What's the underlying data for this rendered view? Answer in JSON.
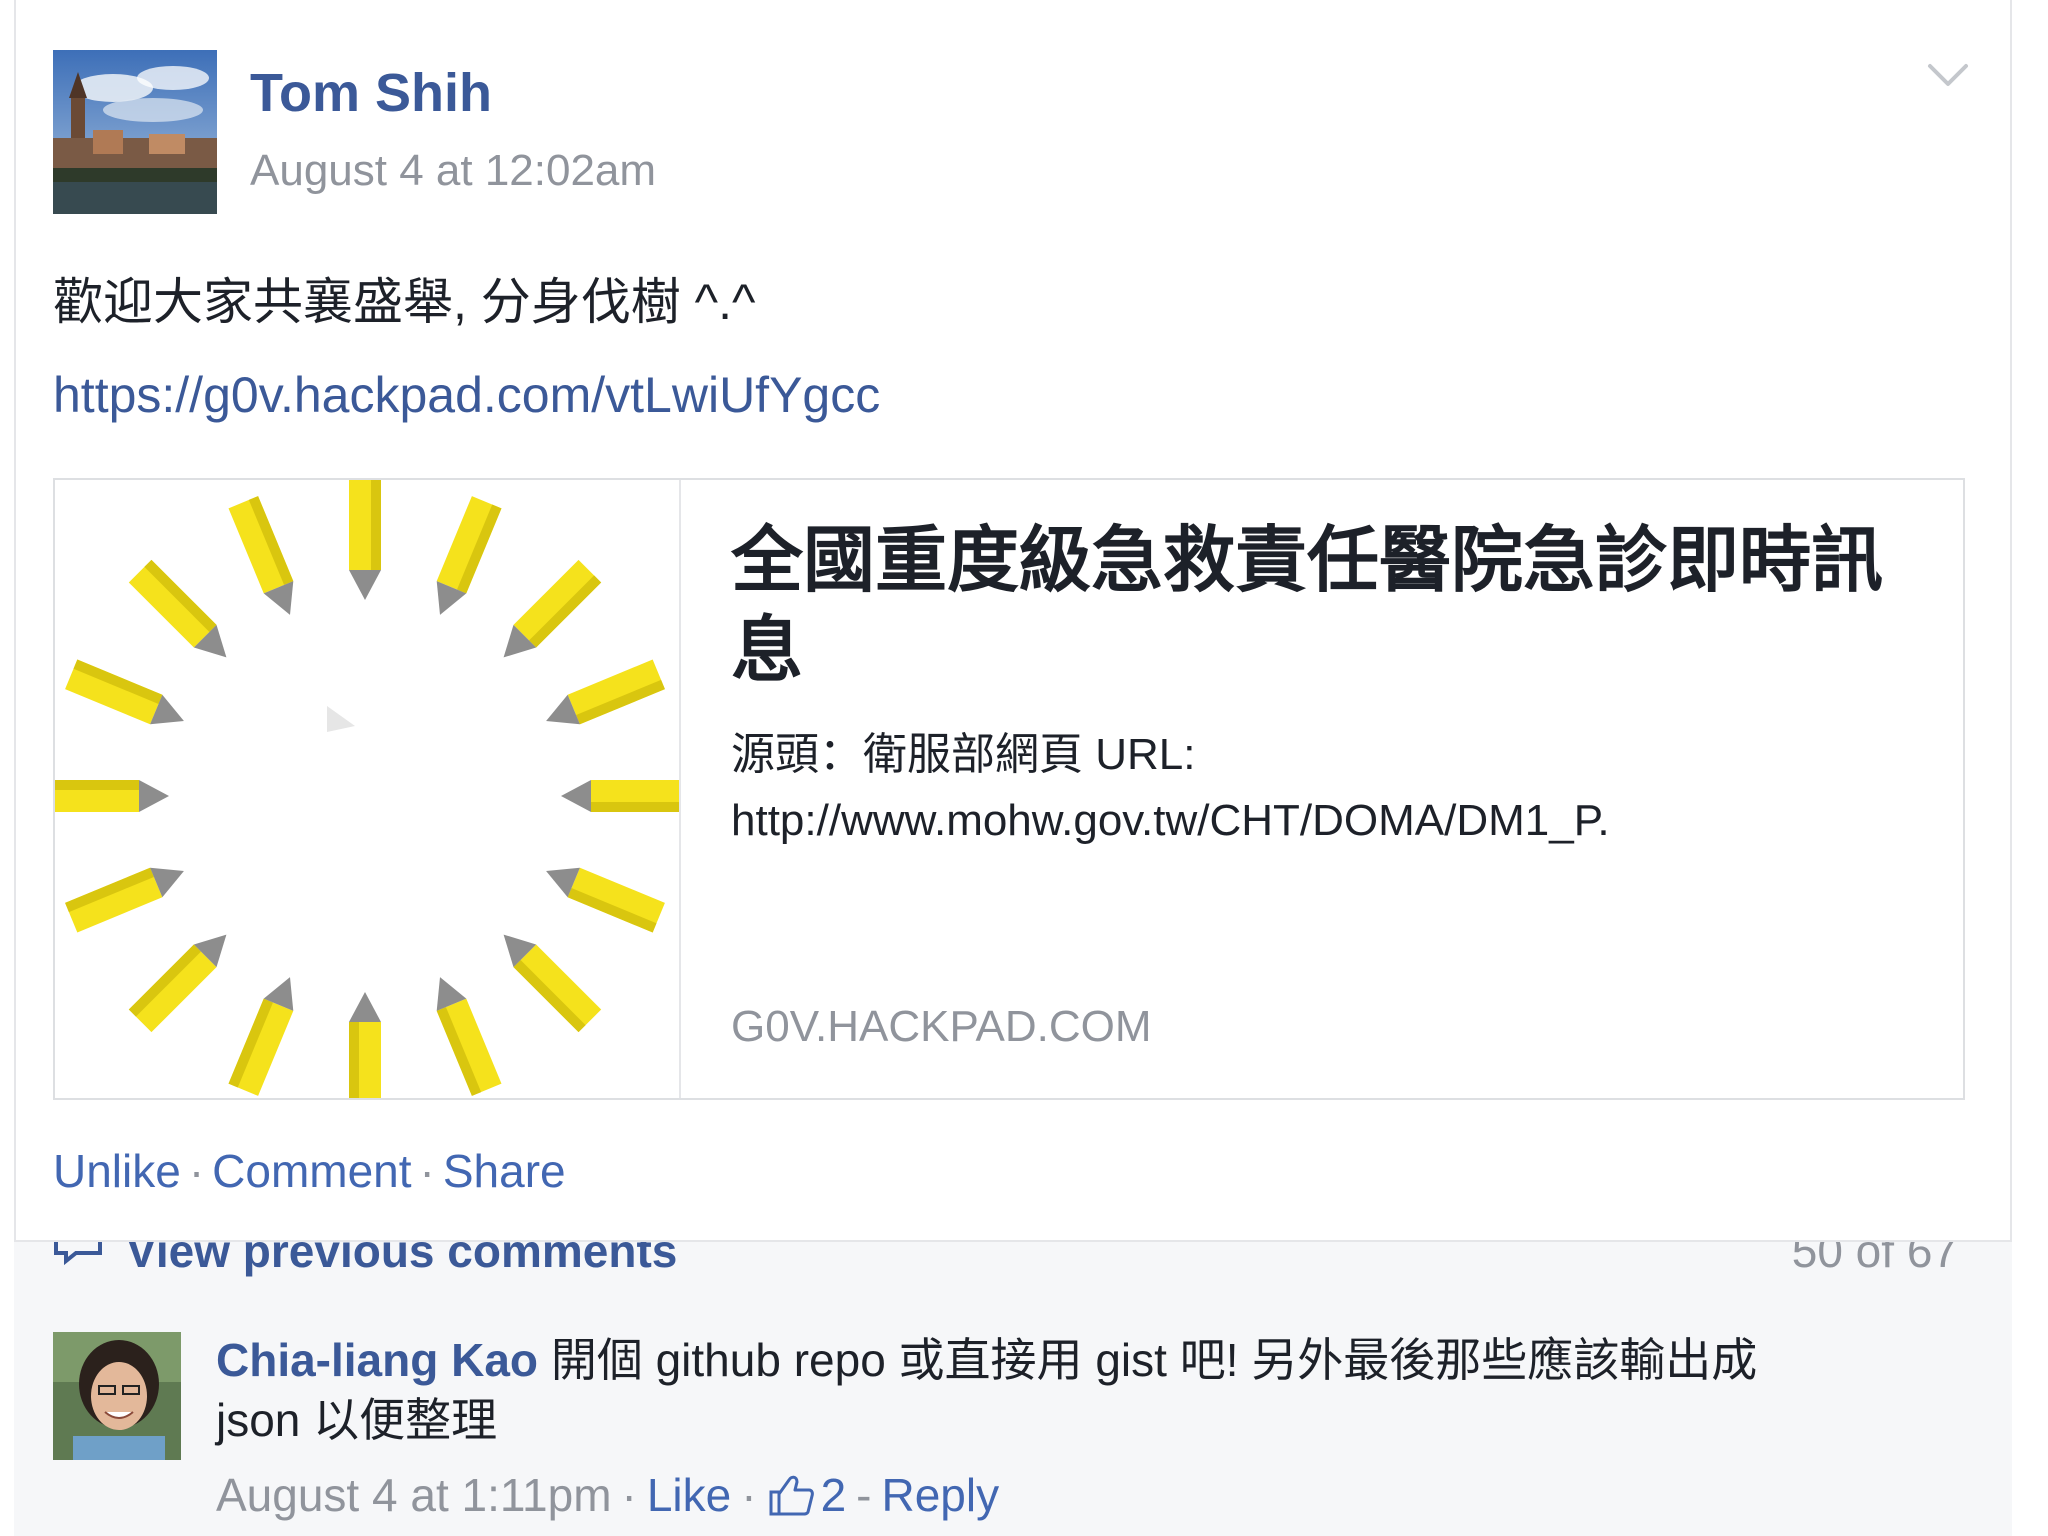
{
  "post": {
    "author": "Tom Shih",
    "timestamp": "August 4 at 12:02am",
    "text": "歡迎大家共襄盛舉, 分身伐樹 ^.^",
    "link": "https://g0v.hackpad.com/vtLwiUfYgcc",
    "menu_icon": "chevron-down-icon"
  },
  "link_preview": {
    "image_icon": "pencil-spinner-logo",
    "title": "全國重度級急救責任醫院急診即時訊息",
    "description_line1": "源頭：衛服部網頁 URL:",
    "description_line2": "http://www.mohw.gov.tw/CHT/DOMA/DM1_P.",
    "domain": "G0V.HACKPAD.COM"
  },
  "actions": {
    "unlike": "Unlike",
    "comment": "Comment",
    "share": "Share",
    "separator": "·"
  },
  "comments": {
    "view_previous": "View previous comments",
    "count": "50 of 67",
    "items": [
      {
        "author": "Chia-liang Kao",
        "text": "開個 github repo 或直接用 gist 吧! 另外最後那些應該輸出成 json 以便整理",
        "time": "August 4 at 1:11pm",
        "like_label": "Like",
        "like_count": "2",
        "reply_label": "Reply"
      }
    ]
  },
  "colors": {
    "link_blue": "#3b5998",
    "action_blue": "#4267b2",
    "meta_gray": "#90949c",
    "pencil_yellow": "#f5e21c",
    "pencil_tip_gray": "#8d8d8d"
  }
}
